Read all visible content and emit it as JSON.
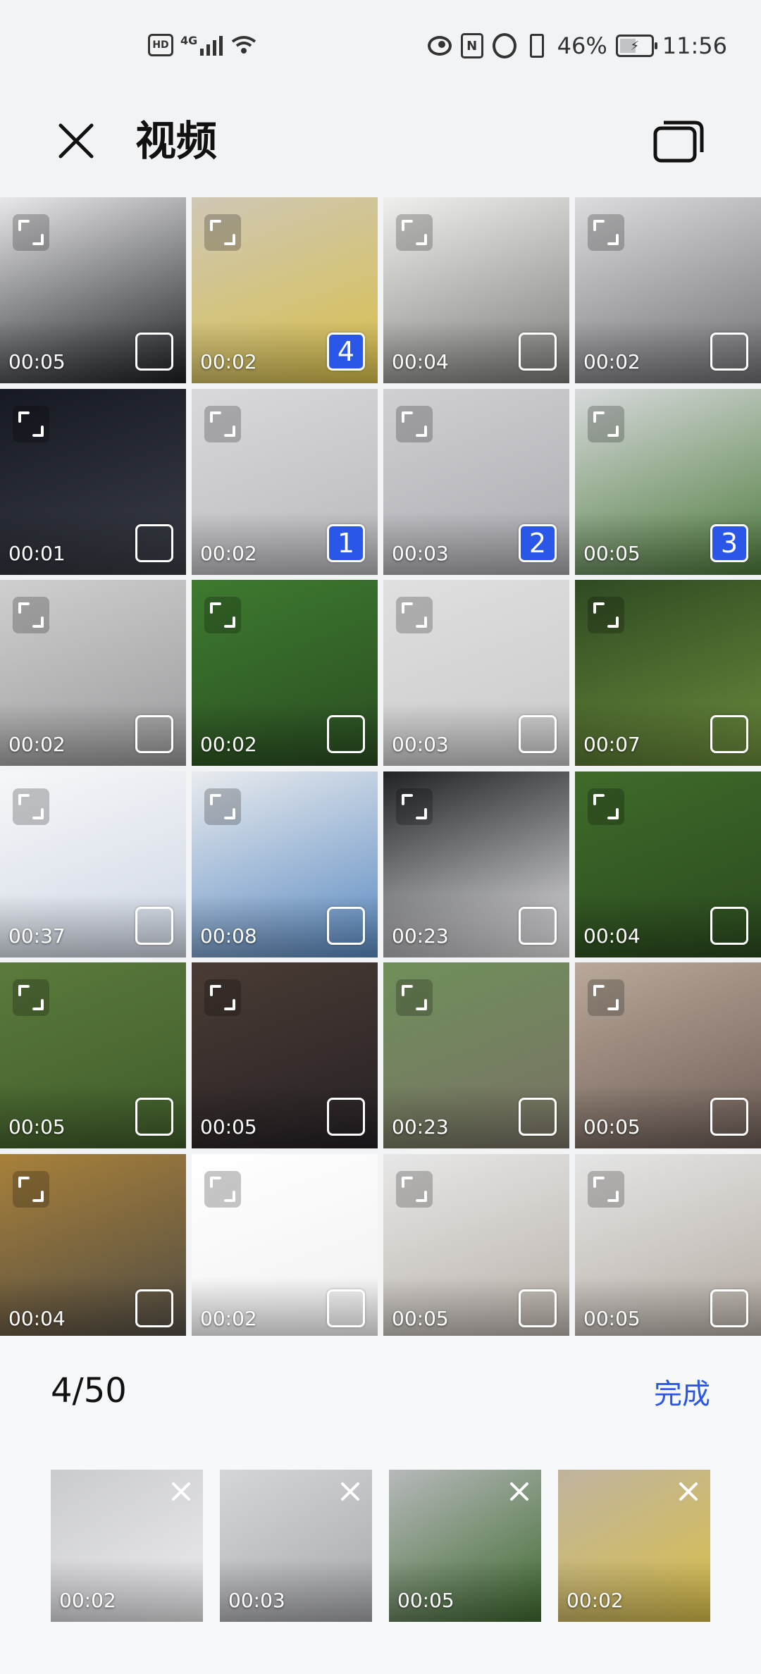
{
  "status_bar": {
    "hd": "HD",
    "network": "4G",
    "battery": "46%",
    "time": "11:56"
  },
  "header": {
    "title": "视频",
    "close_icon": "close-icon",
    "multi_icon": "multi-window-icon"
  },
  "grid": [
    {
      "duration": "00:05",
      "selected": "",
      "colors": [
        "#e8e8ea",
        "#1c1e22"
      ]
    },
    {
      "duration": "00:02",
      "selected": "4",
      "colors": [
        "#cfc7b6",
        "#d8c04a"
      ]
    },
    {
      "duration": "00:04",
      "selected": "",
      "colors": [
        "#efefec",
        "#7b7b78"
      ]
    },
    {
      "duration": "00:02",
      "selected": "",
      "colors": [
        "#dcdcde",
        "#6f6f73"
      ]
    },
    {
      "duration": "00:01",
      "selected": "",
      "colors": [
        "#161922",
        "#3a3d46"
      ]
    },
    {
      "duration": "00:02",
      "selected": "1",
      "colors": [
        "#d9d9dc",
        "#b9b9bd"
      ]
    },
    {
      "duration": "00:03",
      "selected": "2",
      "colors": [
        "#d0d0d4",
        "#aaaab0"
      ]
    },
    {
      "duration": "00:05",
      "selected": "3",
      "colors": [
        "#d7d9db",
        "#4d7a3c"
      ]
    },
    {
      "duration": "00:02",
      "selected": "",
      "colors": [
        "#cfcfd0",
        "#9b9b9d"
      ]
    },
    {
      "duration": "00:02",
      "selected": "",
      "colors": [
        "#3e7a2f",
        "#2a4d22"
      ]
    },
    {
      "duration": "00:03",
      "selected": "",
      "colors": [
        "#e0e0e0",
        "#c9c9c9"
      ]
    },
    {
      "duration": "00:07",
      "selected": "",
      "colors": [
        "#2f4a22",
        "#6b8a3c"
      ]
    },
    {
      "duration": "00:37",
      "selected": "",
      "colors": [
        "#f6f7f9",
        "#cfd7e4"
      ]
    },
    {
      "duration": "00:08",
      "selected": "",
      "colors": [
        "#e9ebee",
        "#5a8ac2"
      ]
    },
    {
      "duration": "00:23",
      "selected": "",
      "colors": [
        "#202226",
        "#e8e8ea"
      ]
    },
    {
      "duration": "00:04",
      "selected": "",
      "colors": [
        "#3f6b2a",
        "#2b4a1f"
      ]
    },
    {
      "duration": "00:05",
      "selected": "",
      "colors": [
        "#5b7a3c",
        "#3f5c2a"
      ]
    },
    {
      "duration": "00:05",
      "selected": "",
      "colors": [
        "#4a3c34",
        "#262125"
      ]
    },
    {
      "duration": "00:23",
      "selected": "",
      "colors": [
        "#6f8f5a",
        "#7a7266"
      ]
    },
    {
      "duration": "00:05",
      "selected": "",
      "colors": [
        "#b9a99a",
        "#6c5c55"
      ]
    },
    {
      "duration": "00:04",
      "selected": "",
      "colors": [
        "#a8813a",
        "#4e4a44"
      ]
    },
    {
      "duration": "00:02",
      "selected": "",
      "colors": [
        "#ffffff",
        "#f1f1f1"
      ]
    },
    {
      "duration": "00:05",
      "selected": "",
      "colors": [
        "#e7e7e7",
        "#b8b0a8"
      ]
    },
    {
      "duration": "00:05",
      "selected": "",
      "colors": [
        "#e5e5e5",
        "#b5aca3"
      ]
    }
  ],
  "panel": {
    "count": "4/50",
    "done_label": "完成",
    "selected": [
      {
        "duration": "00:02",
        "colors": [
          "#cacbcf",
          "#ececee"
        ]
      },
      {
        "duration": "00:03",
        "colors": [
          "#d5d6d9",
          "#a8a9ad"
        ]
      },
      {
        "duration": "00:05",
        "colors": [
          "#b7b9bb",
          "#3f6a30"
        ]
      },
      {
        "duration": "00:02",
        "colors": [
          "#bfb39f",
          "#d9c04a"
        ]
      }
    ]
  },
  "colors": {
    "accent": "#2a57e8",
    "background": "#f1f3f5"
  }
}
